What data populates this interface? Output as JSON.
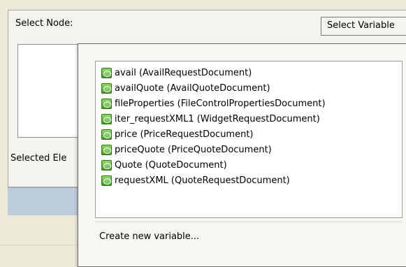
{
  "node_panel": {
    "select_node_label": "Select Node:",
    "selected_element_label": "Selected Ele",
    "select_variable_button": "Select Variable"
  },
  "variable_menu": {
    "items": [
      {
        "label": "avail (AvailRequestDocument)",
        "icon": "variable-icon"
      },
      {
        "label": "availQuote (AvailQuoteDocument)",
        "icon": "variable-icon"
      },
      {
        "label": "fileProperties (FileControlPropertiesDocument)",
        "icon": "variable-icon"
      },
      {
        "label": "iter_requestXML1 (WidgetRequestDocument)",
        "icon": "variable-icon"
      },
      {
        "label": "price (PriceRequestDocument)",
        "icon": "variable-icon"
      },
      {
        "label": "priceQuote (PriceQuoteDocument)",
        "icon": "variable-icon"
      },
      {
        "label": "Quote (QuoteDocument)",
        "icon": "variable-icon"
      },
      {
        "label": "requestXML (QuoteRequestDocument)",
        "icon": "variable-icon"
      }
    ],
    "create_new_label": "Create new variable..."
  },
  "colors": {
    "icon_green": "#4caf2a",
    "strip_blue": "#bcccdd"
  }
}
